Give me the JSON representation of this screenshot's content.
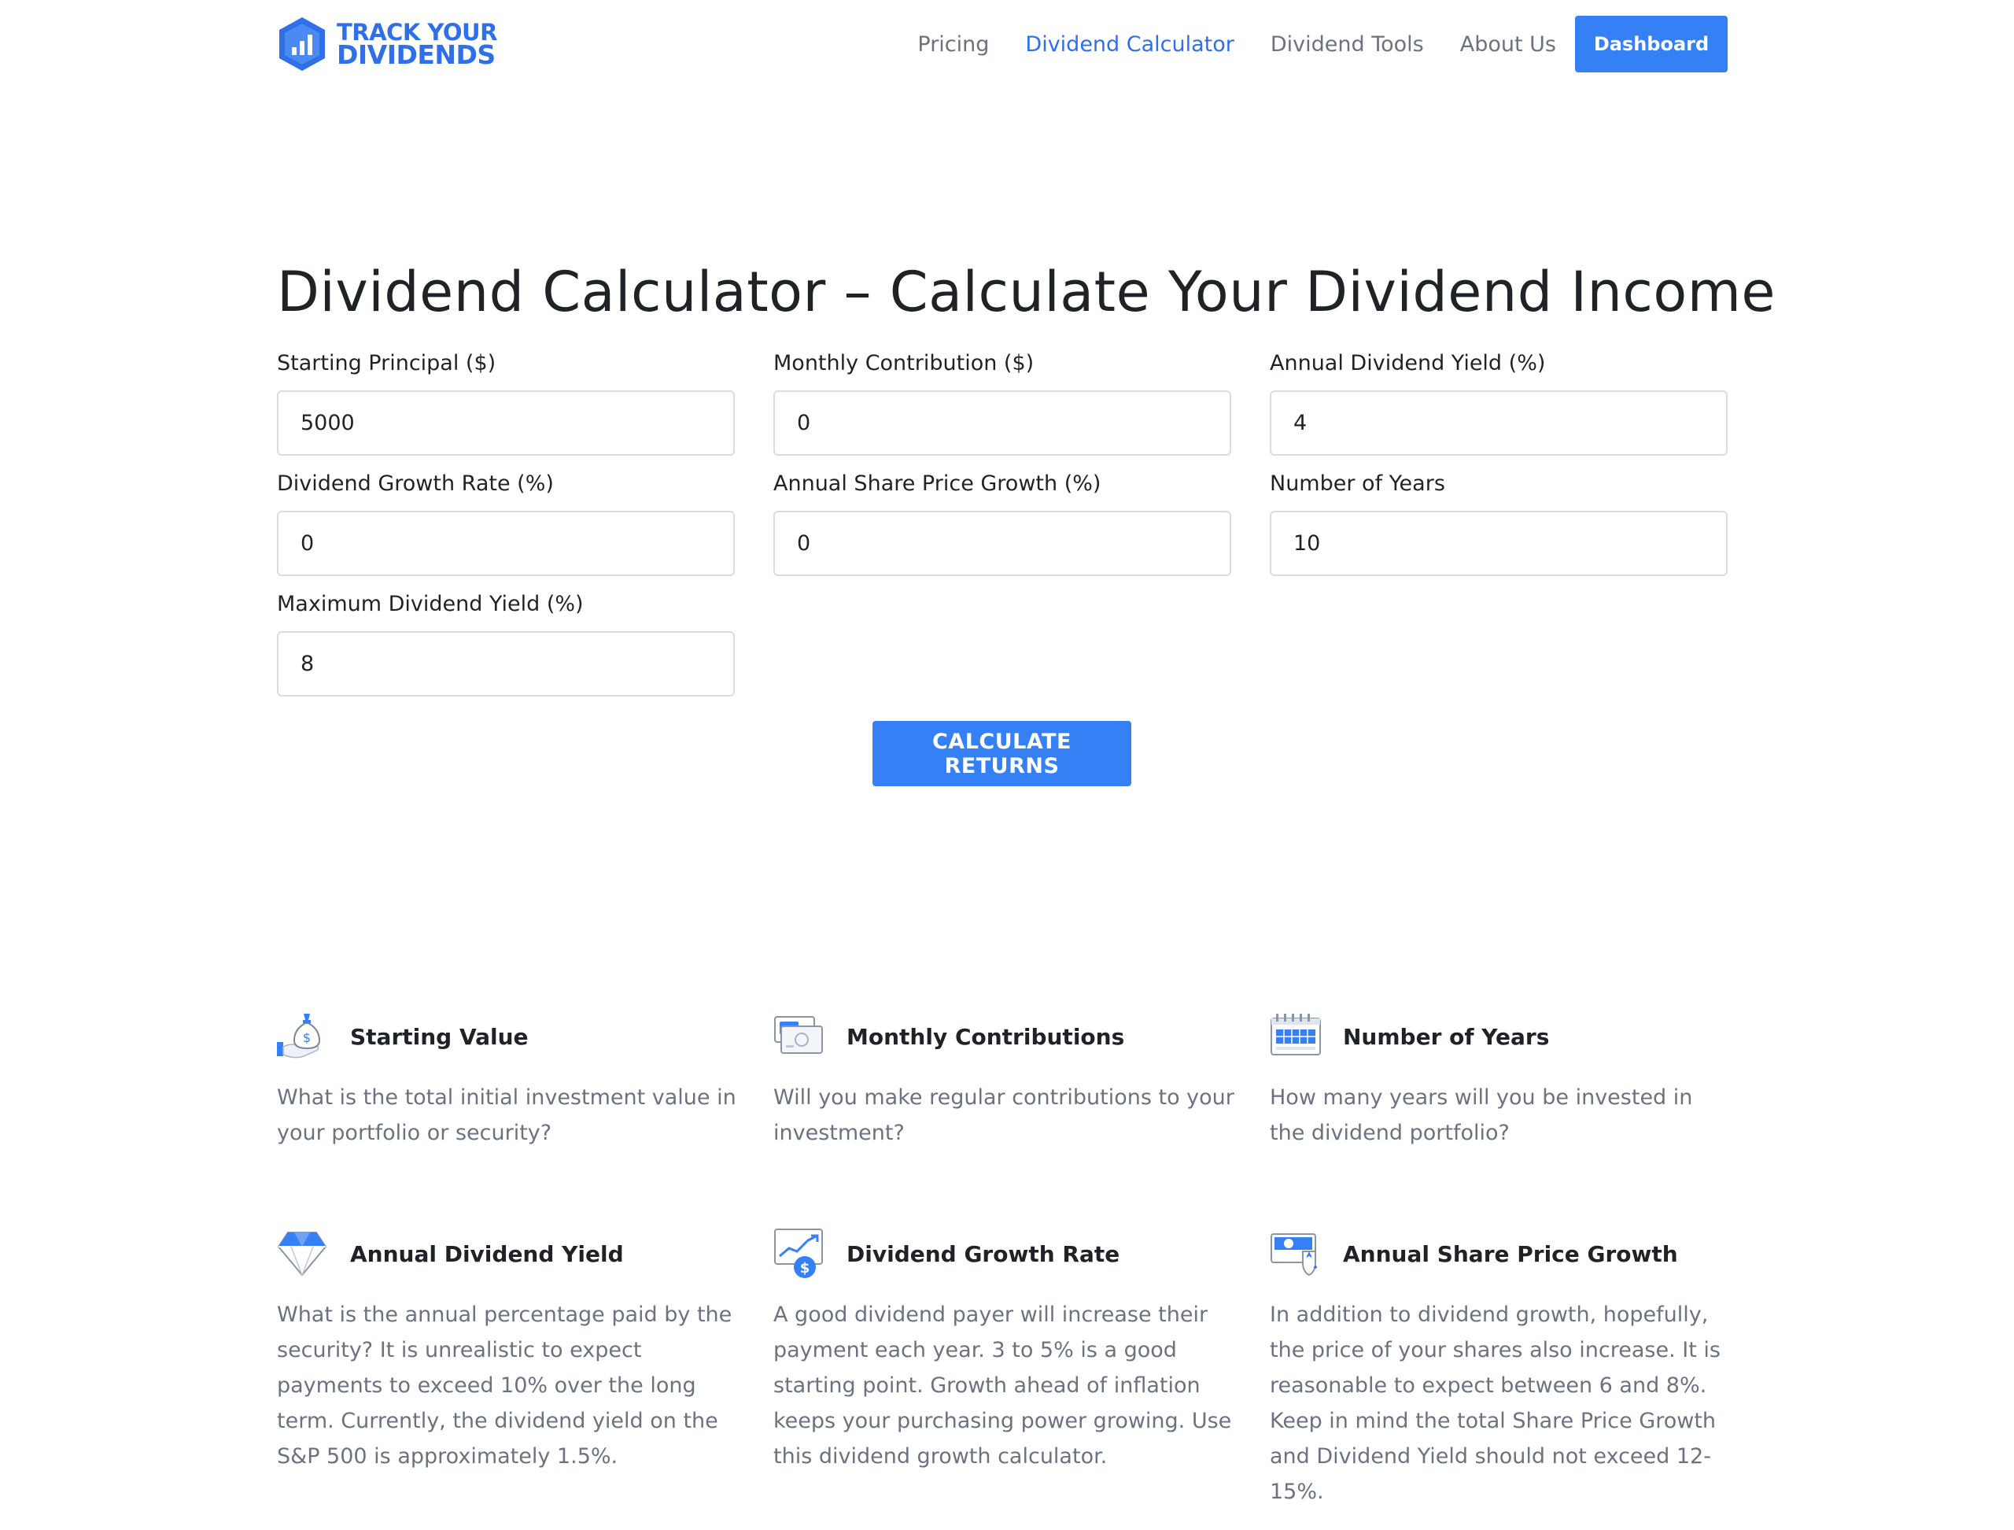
{
  "brand": {
    "line1": "TRACK YOUR",
    "line2": "DIVIDENDS",
    "color": "#2f6fe8"
  },
  "nav": {
    "items": [
      {
        "label": "Pricing",
        "active": false
      },
      {
        "label": "Dividend Calculator",
        "active": true
      },
      {
        "label": "Dividend Tools",
        "active": false
      },
      {
        "label": "About Us",
        "active": false
      }
    ],
    "cta": "Dashboard"
  },
  "page": {
    "title": "Dividend Calculator – Calculate Your Dividend Income"
  },
  "form": {
    "starting_principal": {
      "label": "Starting Principal ($)",
      "value": "5000"
    },
    "monthly_contribution": {
      "label": "Monthly Contribution ($)",
      "value": "0"
    },
    "annual_dividend_yield": {
      "label": "Annual Dividend Yield (%)",
      "value": "4"
    },
    "dividend_growth_rate": {
      "label": "Dividend Growth Rate (%)",
      "value": "0"
    },
    "annual_share_price_growth": {
      "label": "Annual Share Price Growth (%)",
      "value": "0"
    },
    "number_of_years": {
      "label": "Number of Years",
      "value": "10"
    },
    "maximum_dividend_yield": {
      "label": "Maximum Dividend Yield (%)",
      "value": "8"
    },
    "submit_label": "CALCULATE RETURNS"
  },
  "features": {
    "starting_value": {
      "icon": "money-bag-hand-icon",
      "title": "Starting Value",
      "text": "What is the total initial investment value in your portfolio or security?"
    },
    "monthly_contributions": {
      "icon": "cash-bills-icon",
      "title": "Monthly Contributions",
      "text": "Will you make regular contributions to your investment?"
    },
    "number_of_years": {
      "icon": "calendar-icon",
      "title": "Number of Years",
      "text": "How many years will you be invested in the dividend portfolio?"
    },
    "annual_dividend_yield": {
      "icon": "diamond-icon",
      "title": "Annual Dividend Yield",
      "text": "What is the annual percentage paid by the security?  It is unrealistic to expect payments to exceed 10% over the long term.  Currently, the dividend yield on the S&P 500 is approximately 1.5%."
    },
    "dividend_growth_rate": {
      "icon": "growth-chart-dollar-icon",
      "title": "Dividend Growth Rate",
      "text": "A good dividend payer will increase their payment each year.  3 to 5% is a good starting point.  Growth ahead of inflation keeps your purchasing power growing.  Use this dividend growth calculator."
    },
    "annual_share_price_growth": {
      "icon": "card-shield-icon",
      "title": "Annual Share Price Growth",
      "text": "In addition to dividend growth, hopefully, the price of your shares also increase.  It is reasonable to expect between 6 and 8%.  Keep in mind the total Share Price Growth and Dividend Yield should not exceed 12-15%."
    }
  },
  "colors": {
    "accent": "#3580f4",
    "text": "#1f2328",
    "muted": "#6b7280",
    "border": "#d9dde3"
  }
}
